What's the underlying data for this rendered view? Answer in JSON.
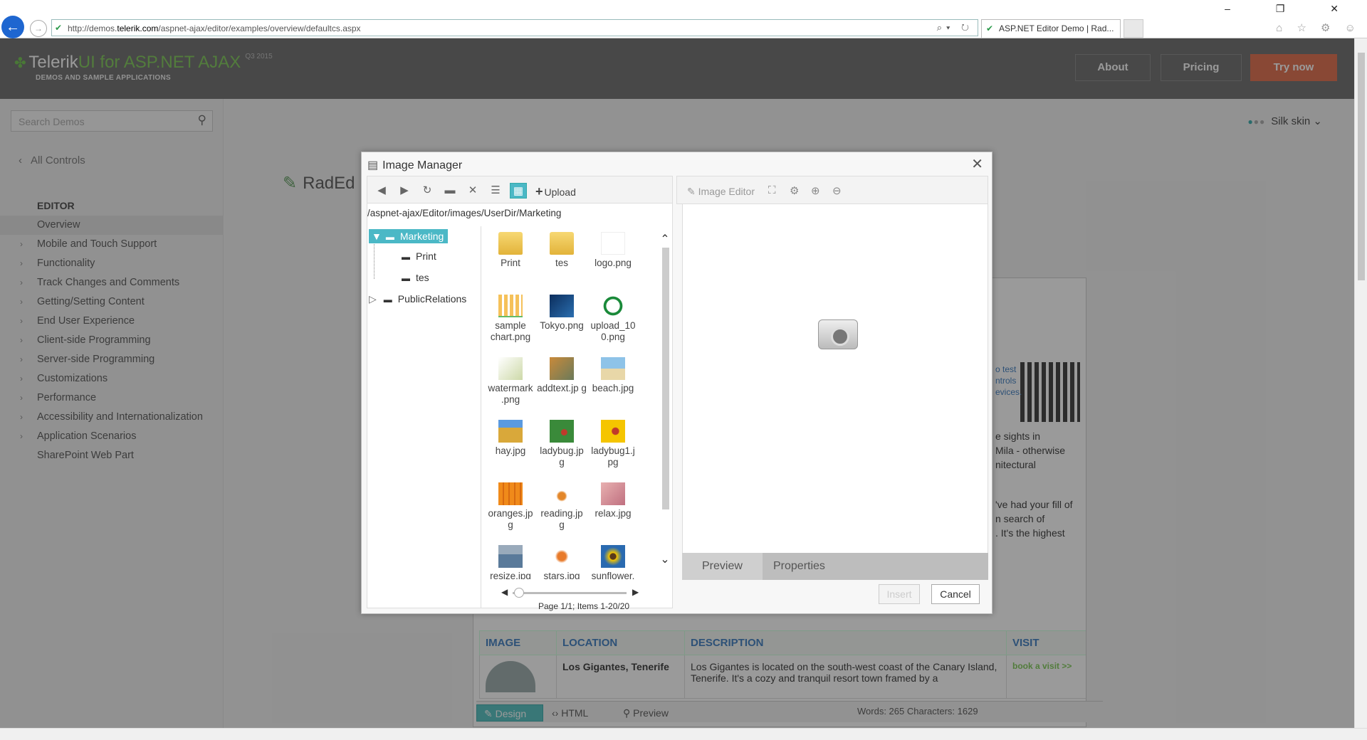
{
  "browser": {
    "url_prefix": "http://demos.",
    "url_domain": "telerik.com",
    "url_path": "/aspnet-ajax/editor/examples/overview/defaultcs.aspx",
    "tab_title": "ASP.NET Editor Demo | Rad...",
    "window_controls": "–  ❐  ✕",
    "toolbar_icons": "⌂ ☆ ⚙ ☺",
    "address_tools": "⌕▾ ↻"
  },
  "header": {
    "brand": "Telerik",
    "product": "UI for ASP.NET AJAX",
    "version": "Q3 2015",
    "subtitle": "DEMOS AND SAMPLE APPLICATIONS",
    "about": "About",
    "pricing": "Pricing",
    "try_now": "Try now",
    "accent_color": "#e06a47",
    "brand_color": "#7cc955"
  },
  "sidebar": {
    "search_placeholder": "Search Demos",
    "all_controls": "All Controls",
    "section": "EDITOR",
    "items": [
      {
        "label": "Overview",
        "expandable": false
      },
      {
        "label": "Mobile and Touch Support",
        "expandable": true
      },
      {
        "label": "Functionality",
        "expandable": true
      },
      {
        "label": "Track Changes and Comments",
        "expandable": true
      },
      {
        "label": "Getting/Setting Content",
        "expandable": true
      },
      {
        "label": "End User Experience",
        "expandable": true
      },
      {
        "label": "Client-side Programming",
        "expandable": true
      },
      {
        "label": "Server-side Programming",
        "expandable": true
      },
      {
        "label": "Customizations",
        "expandable": true
      },
      {
        "label": "Performance",
        "expandable": true
      },
      {
        "label": "Accessibility and Internationalization",
        "expandable": true
      },
      {
        "label": "Application Scenarios",
        "expandable": true
      },
      {
        "label": "SharePoint Web Part",
        "expandable": false
      }
    ]
  },
  "main": {
    "skin": "Silk skin",
    "demo_title": "RadEd"
  },
  "editor": {
    "side_text": [
      "o test",
      "ntrols",
      "evices.",
      "e sights in",
      "Mila - otherwise",
      "nitectural",
      "'ve had your fill of",
      "n search of",
      ". It's the highest"
    ],
    "table_headers": [
      "IMAGE",
      "LOCATION",
      "DESCRIPTION",
      "VISIT"
    ],
    "row_location": "Los Gigantes, Tenerife",
    "row_description": "Los Gigantes is located on the south-west coast of the Canary Island, Tenerife. It's a cozy and tranquil resort town framed by a",
    "row_visit": "book a visit >>",
    "tabs": {
      "design": "Design",
      "html": "HTML",
      "preview": "Preview"
    },
    "counts": "Words: 265   Characters: 1629"
  },
  "dialog": {
    "title": "Image Manager",
    "upload": "Upload",
    "path": "/aspnet-ajax/Editor/images/UserDir/Marketing",
    "tree": {
      "root": "Marketing",
      "children": [
        "Print",
        "tes"
      ],
      "sibling": "PublicRelations"
    },
    "files": [
      {
        "name": "Print",
        "kind": "folder"
      },
      {
        "name": "tes",
        "kind": "folder"
      },
      {
        "name": "logo.png",
        "kind": "logo"
      },
      {
        "name": "sample chart.png",
        "kind": "chart"
      },
      {
        "name": "Tokyo.png",
        "kind": "tokyo"
      },
      {
        "name": "upload_10 0.png",
        "kind": "upload"
      },
      {
        "name": "watermark .png",
        "kind": "watermark"
      },
      {
        "name": "addtext.jp g",
        "kind": "addtext"
      },
      {
        "name": "beach.jpg",
        "kind": "beach"
      },
      {
        "name": "hay.jpg",
        "kind": "hay"
      },
      {
        "name": "ladybug.jp g",
        "kind": "ladybug"
      },
      {
        "name": "ladybug1.j pg",
        "kind": "ladybug1"
      },
      {
        "name": "oranges.jp g",
        "kind": "oranges"
      },
      {
        "name": "reading.jp g",
        "kind": "reading"
      },
      {
        "name": "relax.jpg",
        "kind": "relax"
      },
      {
        "name": "resize.jpg",
        "kind": "resize"
      },
      {
        "name": "stars.jpg",
        "kind": "stars"
      },
      {
        "name": "sunflower. jpg",
        "kind": "sunflower"
      }
    ],
    "pager": "Page 1/1; Items 1-20/20",
    "image_editor": "Image Editor",
    "preview_tab": "Preview",
    "properties_tab": "Properties",
    "insert": "Insert",
    "cancel": "Cancel"
  }
}
